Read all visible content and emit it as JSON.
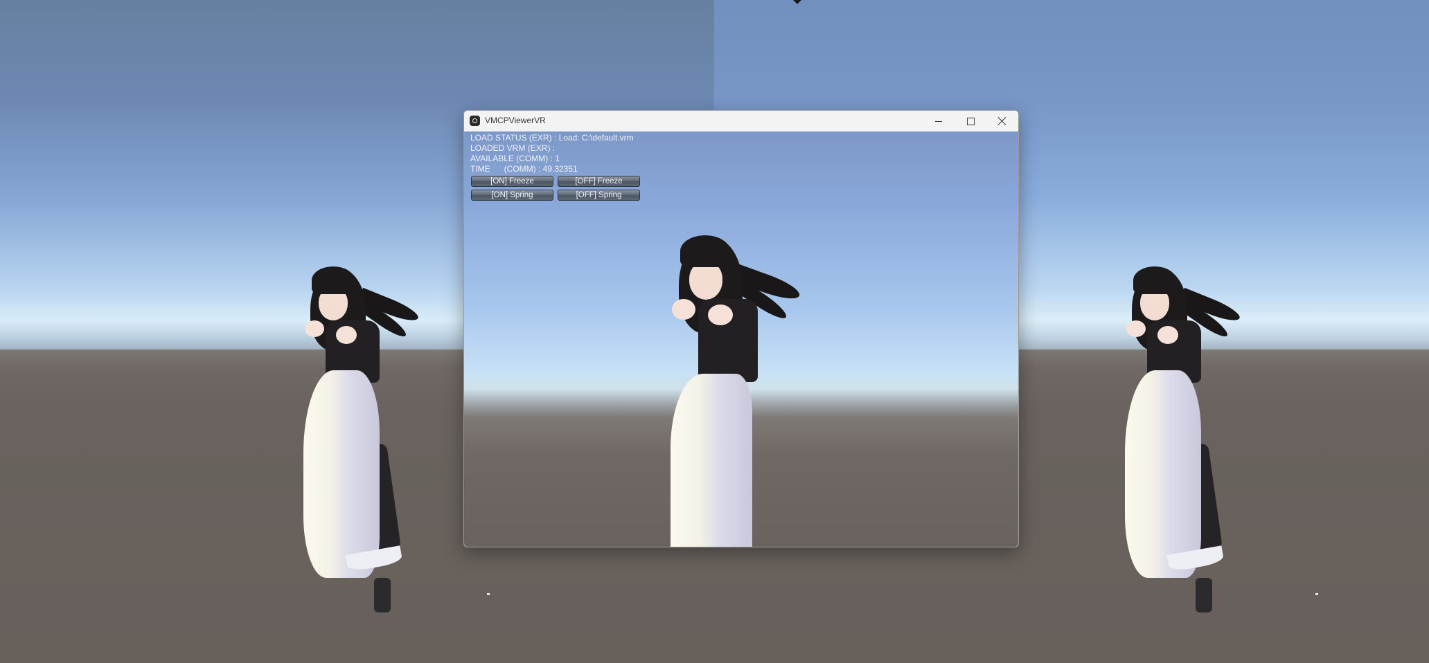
{
  "window": {
    "title": "VMCPViewerVR",
    "controls": {
      "minimize": "minimize-icon",
      "maximize": "maximize-icon",
      "close": "close-icon"
    }
  },
  "status": {
    "load_status": "LOAD STATUS (EXR) : Load: C:\\default.vrm",
    "loaded_vrm": "LOADED VRM (EXR) :",
    "available": "AVAILABLE (COMM) : 1",
    "time": "TIME      (COMM) : 49.32351"
  },
  "buttons": {
    "freeze_on": "[ON] Freeze",
    "freeze_off": "[OFF] Freeze",
    "spring_on": "[ON] Spring",
    "spring_off": "[OFF] Spring"
  },
  "colors": {
    "sky": "#86a6d4",
    "horizon": "#d9ecf8",
    "ground": "#69625e",
    "button": "#5d6876"
  }
}
